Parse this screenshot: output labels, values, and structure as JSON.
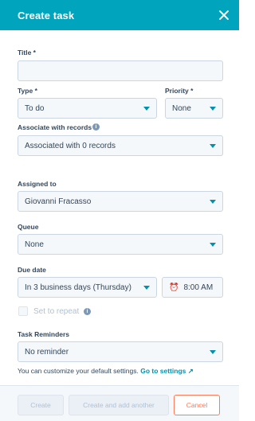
{
  "header": {
    "title": "Create task"
  },
  "form": {
    "title": {
      "label": "Title *",
      "value": ""
    },
    "type": {
      "label": "Type *",
      "value": "To do"
    },
    "priority": {
      "label": "Priority *",
      "value": "None"
    },
    "associate": {
      "label": "Associate with records",
      "value": "Associated with 0 records"
    },
    "assigned": {
      "label": "Assigned to",
      "value": "Giovanni Fracasso"
    },
    "queue": {
      "label": "Queue",
      "value": "None"
    },
    "due": {
      "label": "Due date",
      "date_value": "In 3 business days (Thursday)",
      "time_value": "8:00 AM"
    },
    "repeat": {
      "label": "Set to repeat"
    },
    "reminders": {
      "label": "Task Reminders",
      "value": "No reminder"
    },
    "helper_text": "You can customize your default settings.",
    "helper_link": "Go to settings"
  },
  "footer": {
    "create_label": "Create",
    "create_another_label": "Create and add another",
    "cancel_label": "Cancel"
  },
  "colors": {
    "header": "#00a4bd",
    "accent": "#0091ae",
    "cancel": "#ff7a59"
  }
}
